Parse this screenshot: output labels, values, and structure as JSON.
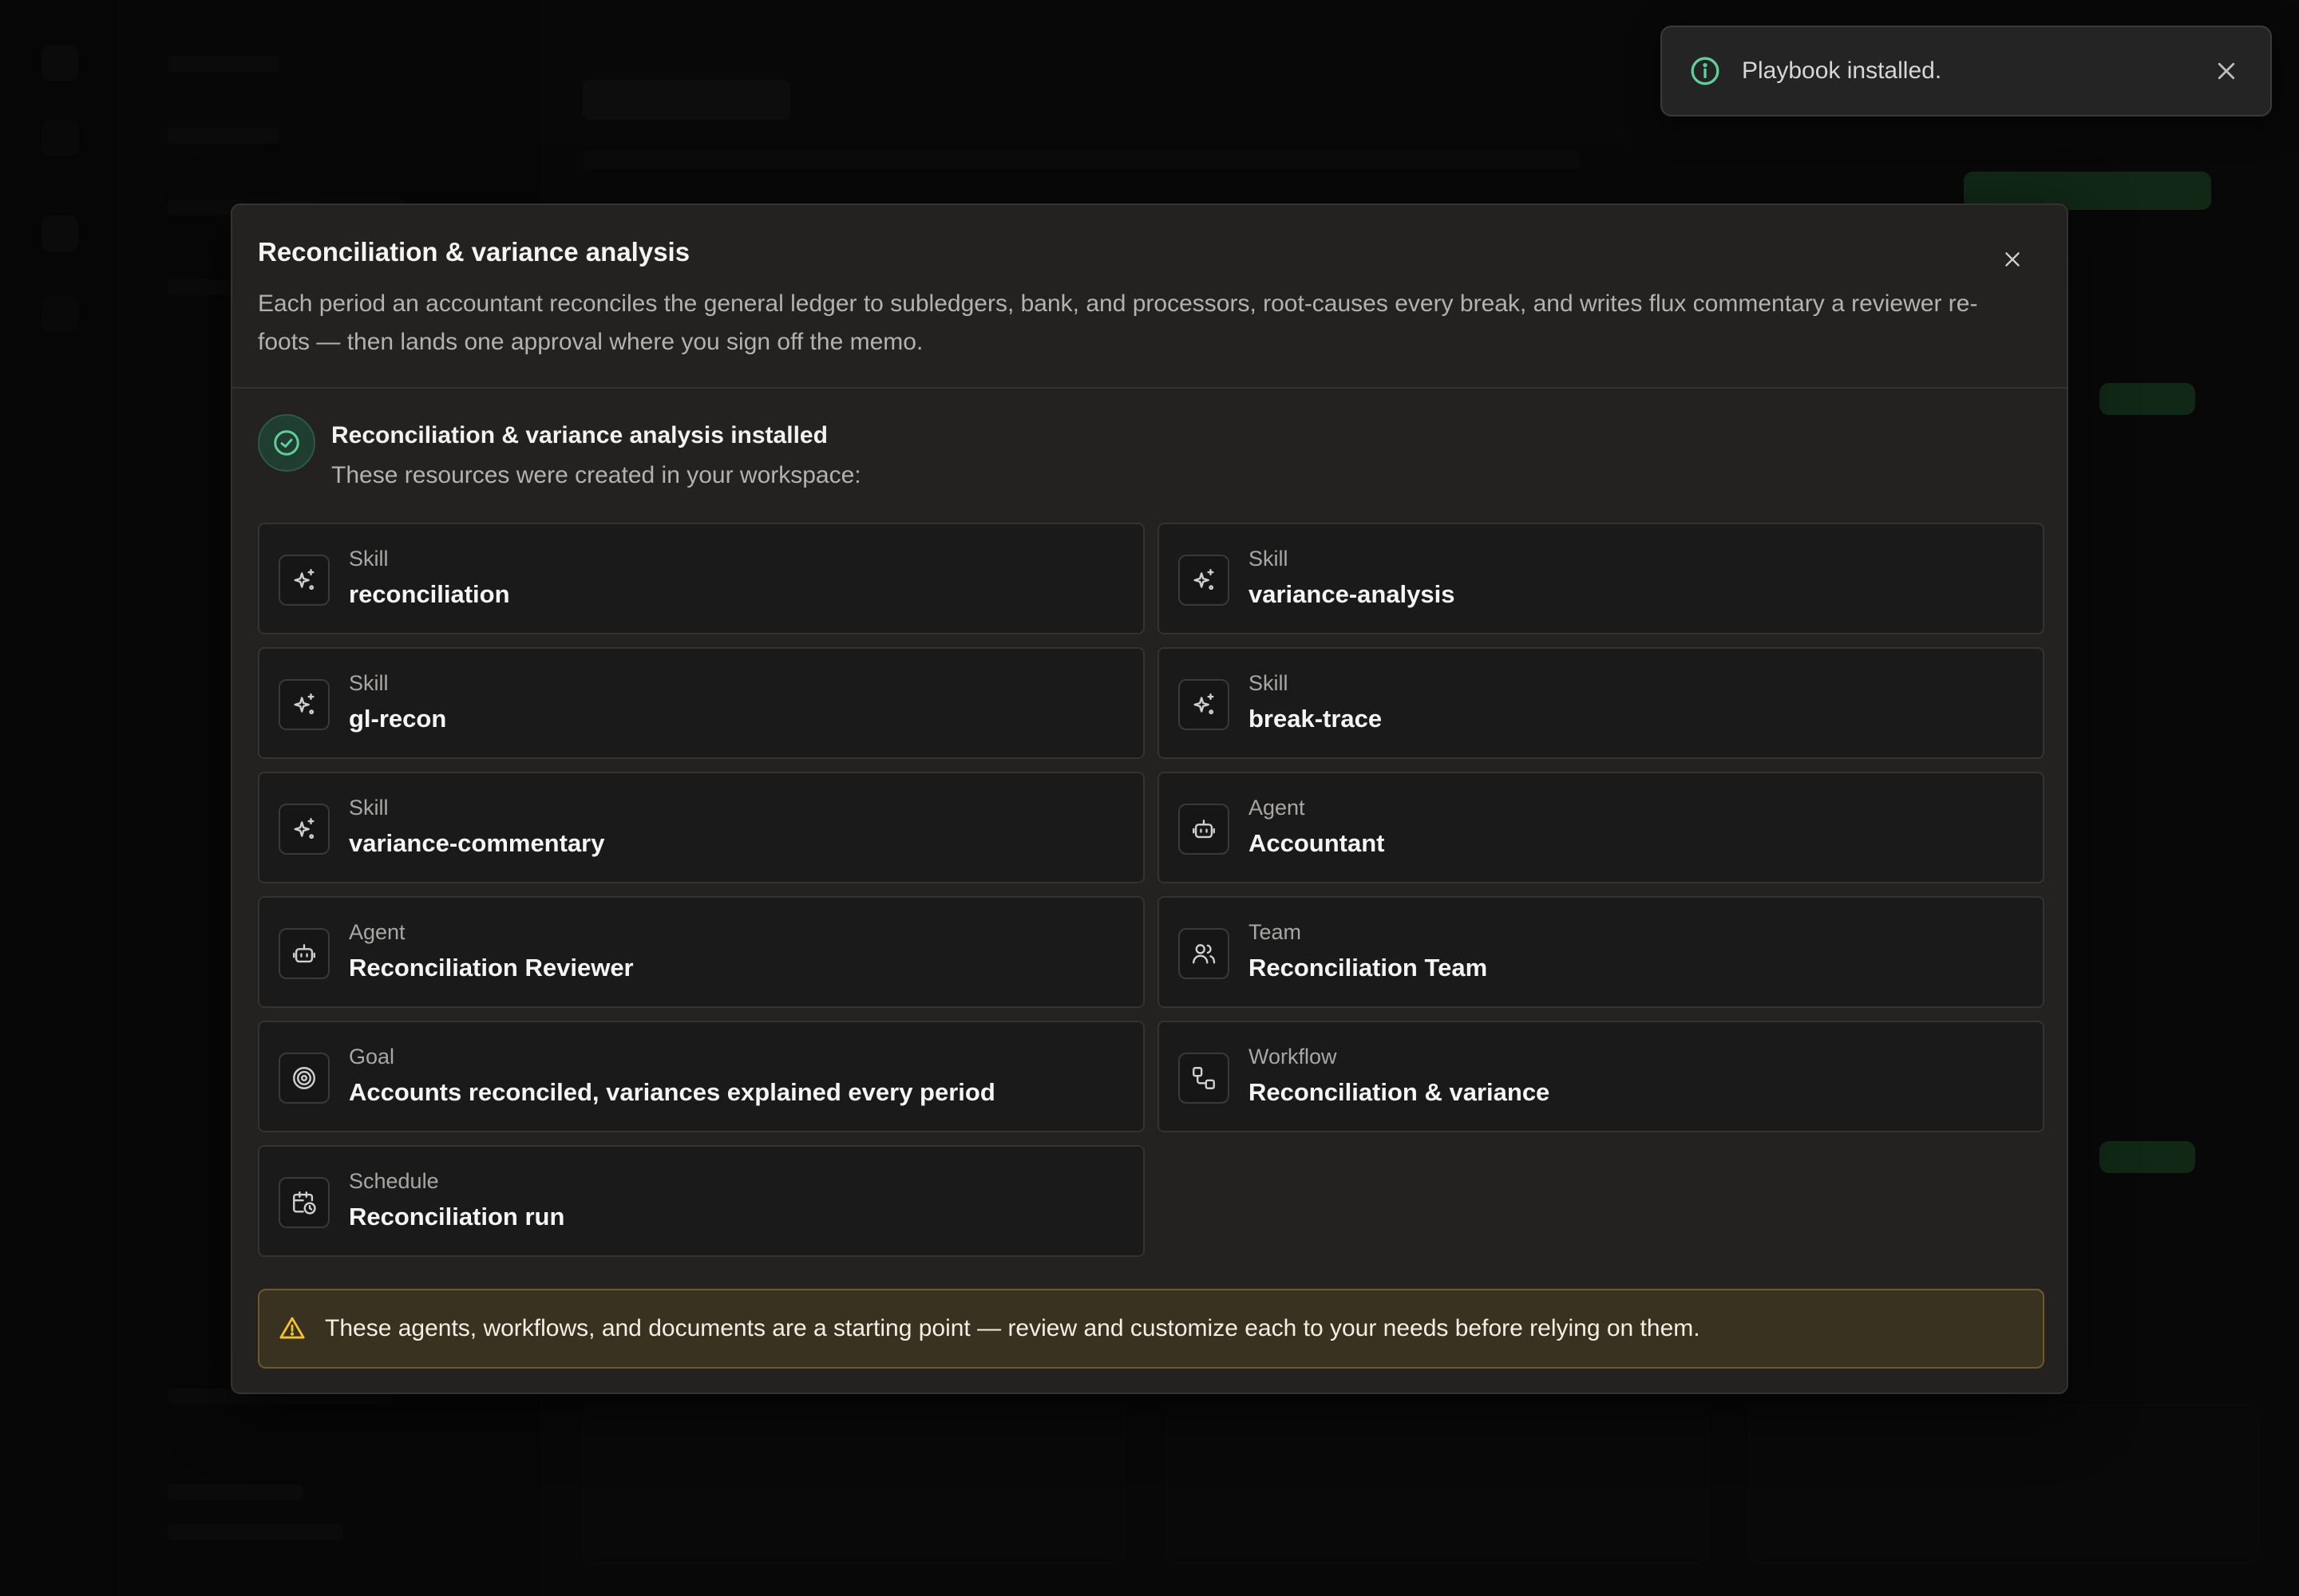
{
  "colors": {
    "success_green": "#5fcf98",
    "warning_yellow": "#f1c232",
    "modal_bg": "#232221",
    "card_bg": "#1a1a1a",
    "warning_bg": "#3a3220"
  },
  "toast": {
    "message": "Playbook installed.",
    "icon": "info-circle-icon",
    "close_icon": "close-icon"
  },
  "modal": {
    "title": "Reconciliation & variance analysis",
    "description": "Each period an accountant reconciles the general ledger to subledgers, bank, and processors, root-causes every break, and writes flux commentary a reviewer re-foots — then lands one approval where you sign off the memo.",
    "close_icon": "close-icon",
    "success": {
      "icon": "check-circle-icon",
      "title": "Reconciliation & variance analysis installed",
      "subtitle": "These resources were created in your workspace:"
    },
    "resources": [
      {
        "kind": "Skill",
        "name": "reconciliation",
        "icon": "sparkle-icon"
      },
      {
        "kind": "Skill",
        "name": "variance-analysis",
        "icon": "sparkle-icon"
      },
      {
        "kind": "Skill",
        "name": "gl-recon",
        "icon": "sparkle-icon"
      },
      {
        "kind": "Skill",
        "name": "break-trace",
        "icon": "sparkle-icon"
      },
      {
        "kind": "Skill",
        "name": "variance-commentary",
        "icon": "sparkle-icon"
      },
      {
        "kind": "Agent",
        "name": "Accountant",
        "icon": "robot-icon"
      },
      {
        "kind": "Agent",
        "name": "Reconciliation Reviewer",
        "icon": "robot-icon"
      },
      {
        "kind": "Team",
        "name": "Reconciliation Team",
        "icon": "users-icon"
      },
      {
        "kind": "Goal",
        "name": "Accounts reconciled, variances explained every period",
        "icon": "target-icon"
      },
      {
        "kind": "Workflow",
        "name": "Reconciliation & variance",
        "icon": "workflow-icon"
      },
      {
        "kind": "Schedule",
        "name": "Reconciliation run",
        "icon": "calendar-clock-icon"
      }
    ],
    "warning": {
      "icon": "warning-triangle-icon",
      "text": "These agents, workflows, and documents are a starting point — review and customize each to your needs before relying on them."
    }
  }
}
